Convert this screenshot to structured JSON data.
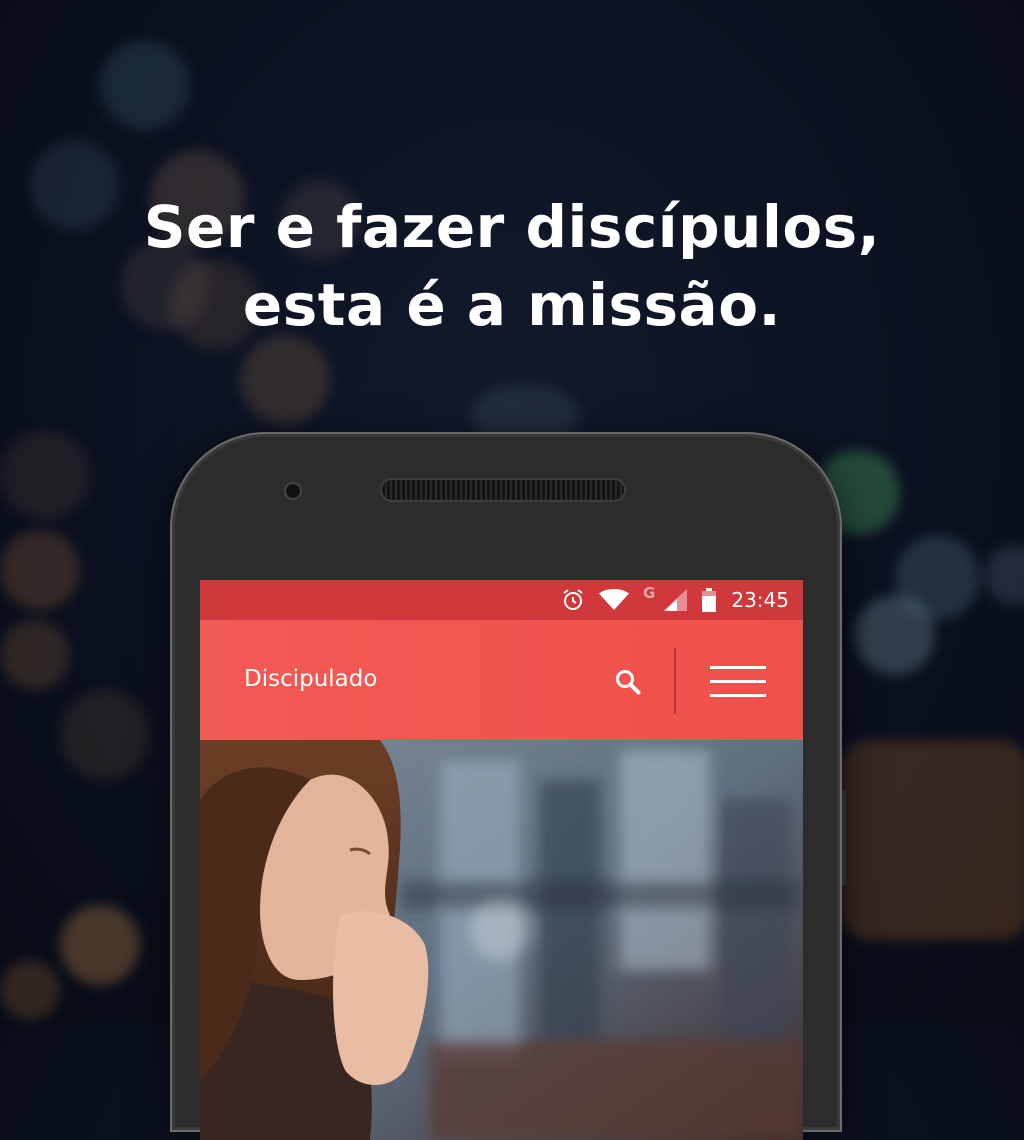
{
  "headline": {
    "line1": "Ser e fazer discípulos,",
    "line2": "esta é a missão."
  },
  "status_bar": {
    "network_label": "G",
    "time": "23:45",
    "icons": [
      "alarm-icon",
      "wifi-icon",
      "signal-icon",
      "battery-icon"
    ]
  },
  "app_bar": {
    "title": "Discipulado",
    "icons": [
      "search-icon",
      "hamburger-menu-icon"
    ]
  },
  "hero_image": {
    "subject": "woman-praying-photo"
  },
  "colors": {
    "status_bar": "#d0383c",
    "app_bar": "#f0504b",
    "background": "#0b1120",
    "text": "#ffffff"
  }
}
